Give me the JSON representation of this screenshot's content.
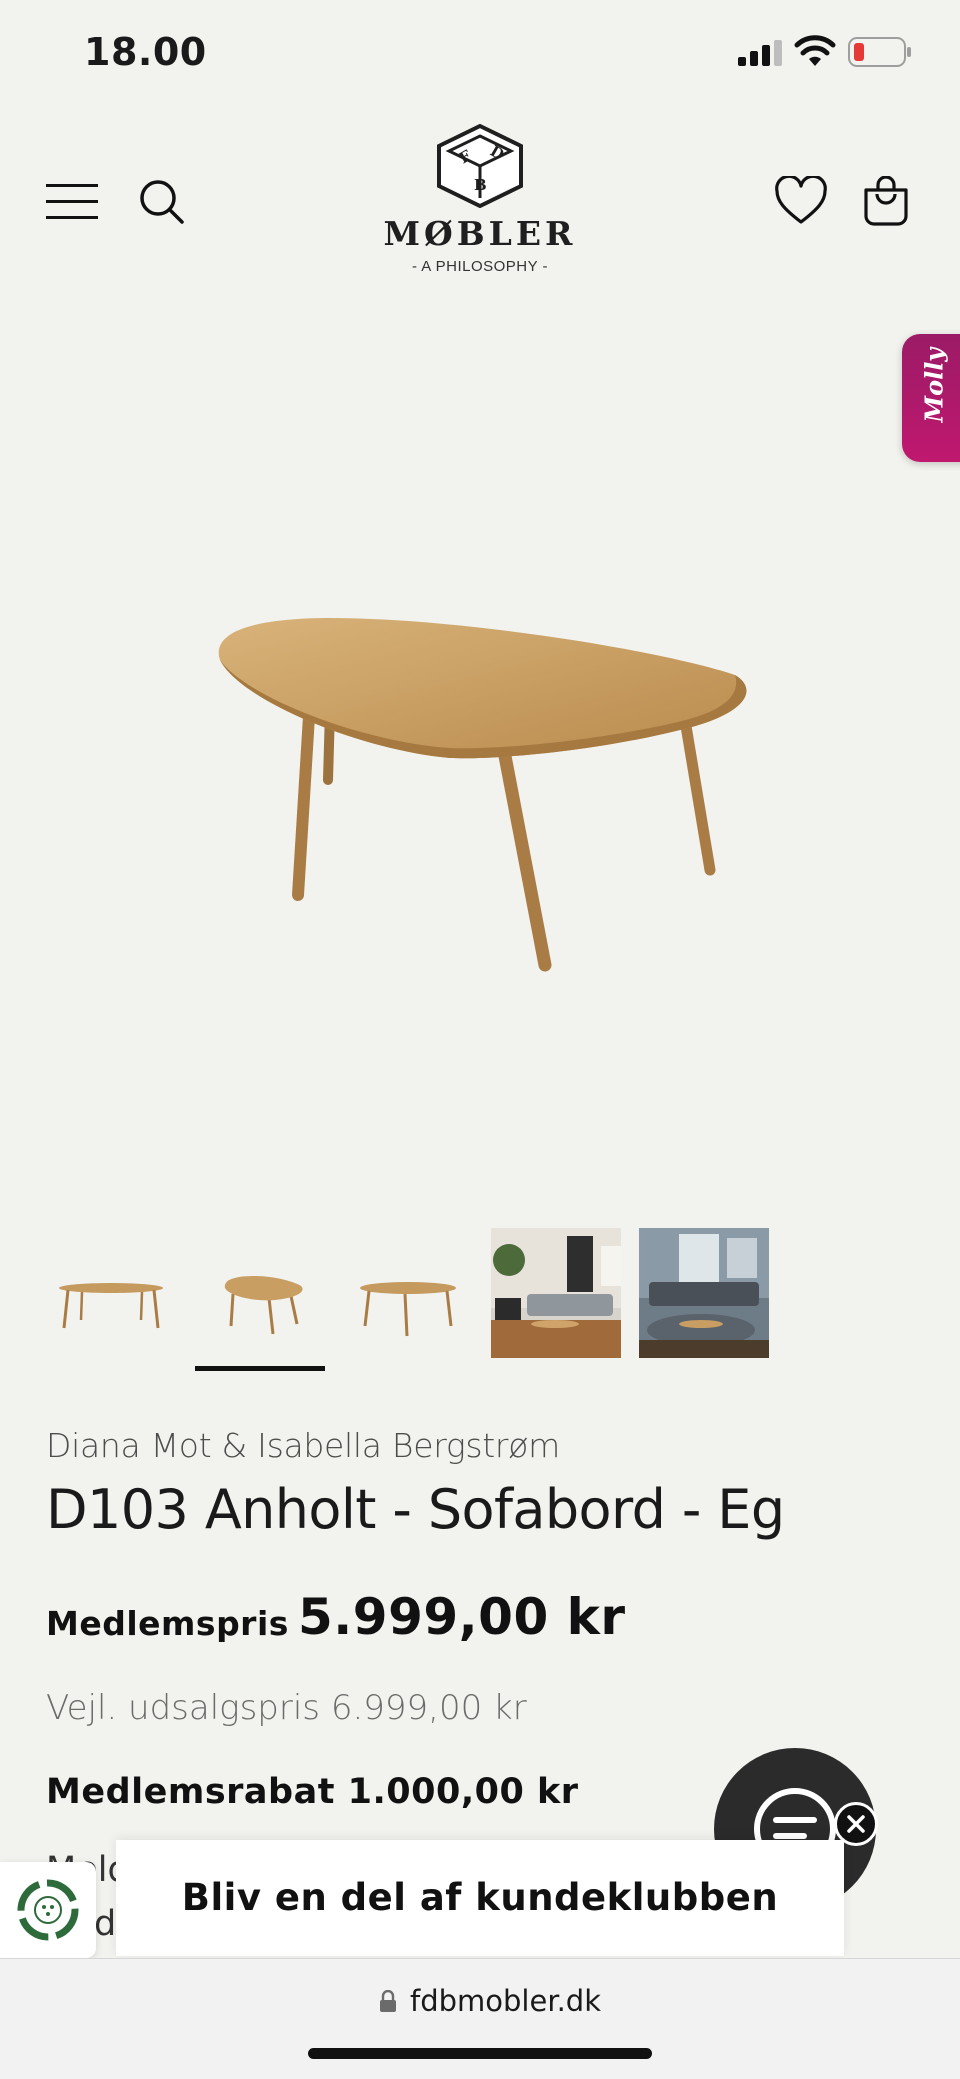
{
  "status_bar": {
    "time": "18.00"
  },
  "header": {
    "logo_brand": "MØBLER",
    "logo_tagline": "- A PHILOSOPHY -",
    "logo_letters": [
      "F",
      "D",
      "B"
    ]
  },
  "molly_tab": {
    "label": "Molly"
  },
  "product": {
    "designer": "Diana Mot & Isabella Bergstrøm",
    "title": "D103 Anholt - Sofabord - Eg",
    "member_price_label": "Medlemspris",
    "member_price": "5.999,00 kr",
    "rrp": "Vejl. udsalgspris 6.999,00 kr",
    "member_discount": "Medlemsrabat 1.000,00 kr",
    "cut_text_1": "Meld",
    "cut_text_2": "d"
  },
  "thumbnails": {
    "active_index": 2,
    "items": [
      "table-oval-side",
      "table-organic-top",
      "table-oval-angle",
      "living-room-photo",
      "living-room-sofa-photo"
    ]
  },
  "banner": {
    "join_label": "Bliv en del af kundeklubben"
  },
  "browser": {
    "url": "fdbmobler.dk"
  },
  "colors": {
    "background": "#f2f2ee",
    "molly_gradient_start": "#9b1b66",
    "molly_gradient_end": "#c0186f",
    "battery_low": "#e53935",
    "wood": "#c9a26a"
  }
}
